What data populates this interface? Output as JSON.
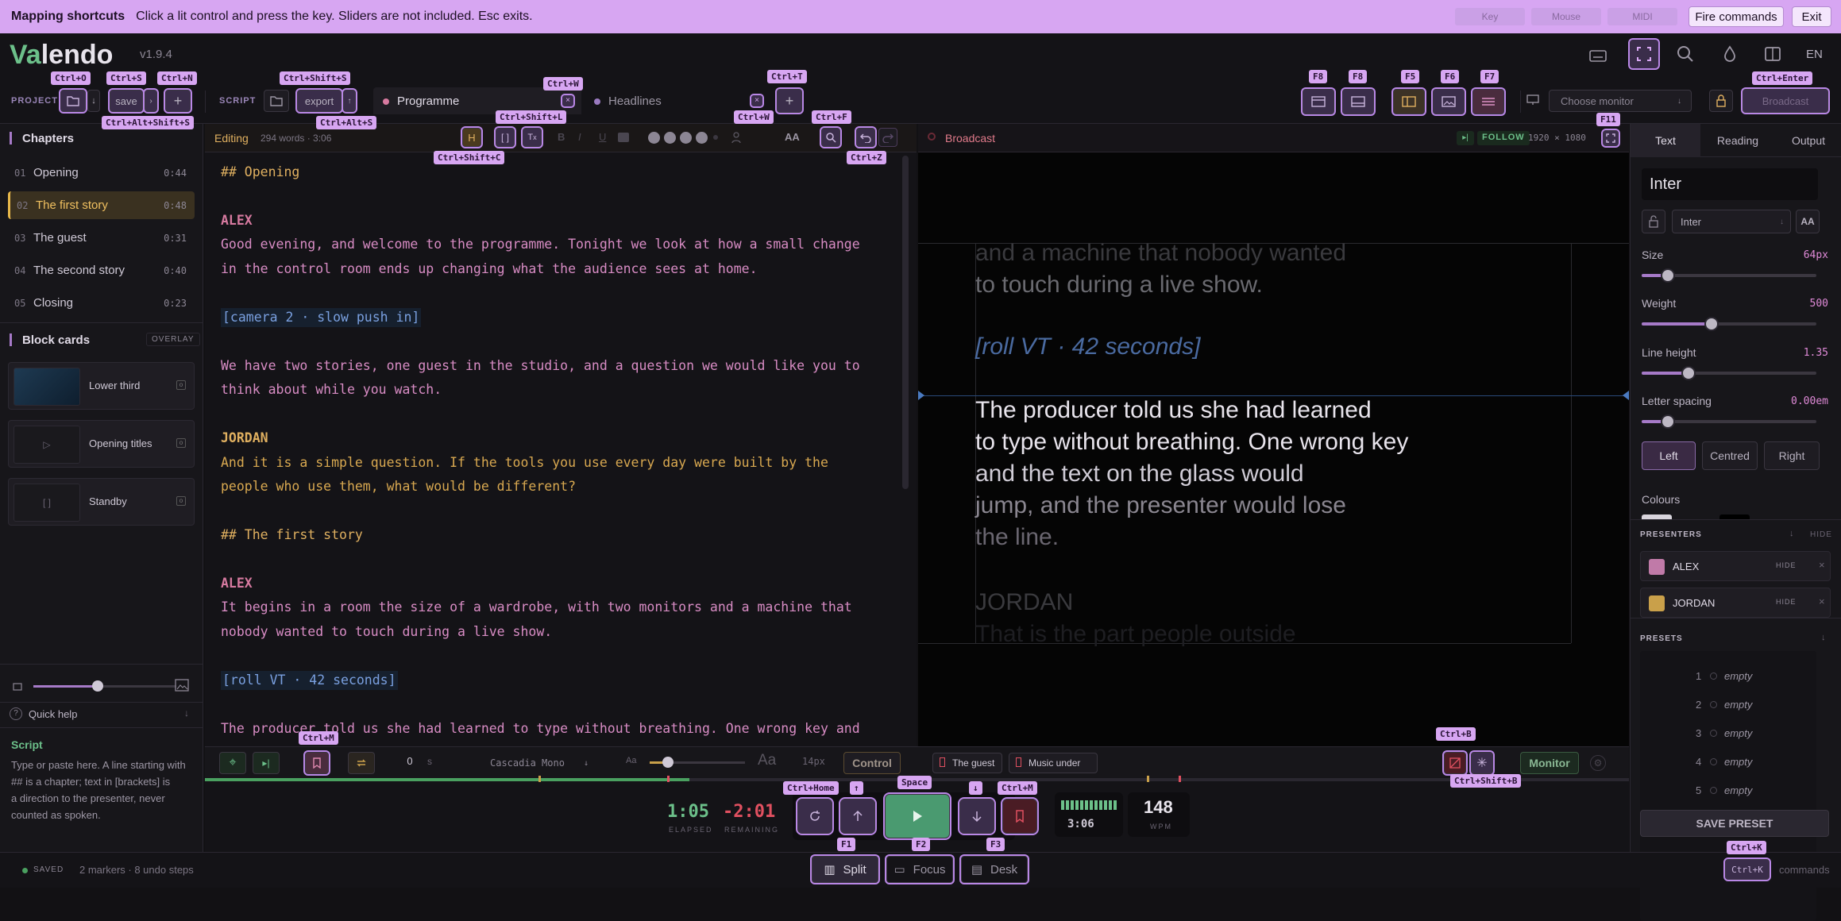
{
  "banner": {
    "title": "Mapping shortcuts",
    "hint": "Click a lit control and press the key. Sliders are not included. Esc exits.",
    "key": "Key",
    "mouse": "Mouse",
    "midi": "MIDI",
    "fire": "Fire commands",
    "exit": "Exit"
  },
  "app": {
    "logo_a": "Va",
    "logo_b": "lendo",
    "version": "v1.9.4",
    "lang": "EN"
  },
  "toolbar": {
    "project_label": "PROJECT",
    "save": "save",
    "script_label": "SCRIPT",
    "export": "export",
    "tab1": "Programme",
    "tab2": "Headlines",
    "monitor_placeholder": "Choose monitor",
    "broadcast": "Broadcast"
  },
  "shortcuts": {
    "open": "Ctrl+O",
    "save": "Ctrl+S",
    "new": "Ctrl+N",
    "save_as": "Ctrl+Alt+Shift+S",
    "export": "Ctrl+Shift+S",
    "export_all": "Ctrl+Alt+S",
    "close_tab": "Ctrl+W",
    "new_tab": "Ctrl+T",
    "close_w": "Ctrl+W",
    "find": "Ctrl+F",
    "undo": "Ctrl+Z",
    "cue": "Ctrl+Shift+C",
    "bracket": "Ctrl+Shift+L",
    "f8a": "F8",
    "f8b": "F8",
    "f5": "F5",
    "f6": "F6",
    "f7": "F7",
    "broadcast": "Ctrl+Enter",
    "fullscreen": "F11",
    "marker": "Ctrl+M",
    "blank": "Ctrl+B",
    "freeze": "Ctrl+Shift+B",
    "home": "Ctrl+Home",
    "up": "↑",
    "space": "Space",
    "down": "↓",
    "mark": "Ctrl+M",
    "f1": "F1",
    "f2": "F2",
    "f3": "F3",
    "cmd": "Ctrl+K"
  },
  "sidebar": {
    "chapters_title": "Chapters",
    "chapters": [
      {
        "n": "01",
        "t": "Opening",
        "d": "0:44"
      },
      {
        "n": "02",
        "t": "The first story",
        "d": "0:48"
      },
      {
        "n": "03",
        "t": "The guest",
        "d": "0:31"
      },
      {
        "n": "04",
        "t": "The second story",
        "d": "0:40"
      },
      {
        "n": "05",
        "t": "Closing",
        "d": "0:23"
      }
    ],
    "cards_title": "Block cards",
    "overlay": "OVERLAY",
    "cards": [
      {
        "name": "Lower third",
        "thumb": ""
      },
      {
        "name": "Opening titles",
        "thumb": "▷"
      },
      {
        "name": "Standby",
        "thumb": "[ ]"
      }
    ],
    "quick_help": "Quick help",
    "help_title": "Script",
    "help_text1": "Type or paste here. A line starting with",
    "help_text2": "## is a chapter; text in [brackets] is",
    "help_text3": "a direction to the presenter, never",
    "help_text4": "counted as spoken."
  },
  "editor": {
    "mode": "Editing",
    "meta": "294 words · 3:06",
    "aa": "AA",
    "lines": [
      "## Opening",
      "ALEX",
      "Good evening, and welcome to the programme. Tonight we look at how a small change",
      "in the control room ends up changing what the audience sees at home.",
      "[camera 2 · slow push in]",
      "We have two stories, one guest in the studio, and a question we would like you to",
      "think about while you watch.",
      "JORDAN",
      "And it is a simple question. If the tools you use every day were built by the",
      "people who use them, what would be different?",
      "## The first story",
      "ALEX",
      "It begins in a room the size of a wardrobe, with two monitors and a machine that",
      "nobody wanted to touch during a live show.",
      "[roll VT · 42 seconds]",
      "The producer told us she had learned to type without breathing. One wrong key and"
    ]
  },
  "broadcast": {
    "title": "Broadcast",
    "follow": "FOLLOW",
    "res": "1920 × 1080",
    "lines": [
      "and a machine that nobody wanted",
      "to touch during a live show.",
      "[roll VT · 42 seconds]",
      "The producer told us she had learned",
      "to type without breathing. One wrong key",
      "and the text on the glass would",
      "jump, and the presenter would lose",
      "the line.",
      "JORDAN",
      "That is the part people outside"
    ]
  },
  "rpanel": {
    "tabs": [
      "Text",
      "Reading",
      "Output"
    ],
    "font_name": "Inter",
    "font_sel": "Inter",
    "aa": "AA",
    "size_label": "Size",
    "size_val": "64px",
    "size_pct": 0.15,
    "weight_label": "Weight",
    "weight_val": "500",
    "weight_pct": 0.4,
    "lh_label": "Line height",
    "lh_val": "1.35",
    "lh_pct": 0.27,
    "ls_label": "Letter spacing",
    "ls_val": "0.00em",
    "ls_pct": 0.15,
    "align": [
      "Left",
      "Centred",
      "Right"
    ],
    "colours": "Colours",
    "presenters_title": "PRESENTERS",
    "hide": "HIDE",
    "presenters": [
      {
        "name": "ALEX",
        "color": "#c07aa8"
      },
      {
        "name": "JORDAN",
        "color": "#c9a04a"
      }
    ],
    "presets_title": "PRESETS",
    "presets": [
      "1",
      "2",
      "3",
      "4",
      "5"
    ],
    "empty": "empty",
    "save_preset": "SAVE PRESET",
    "commands": "commands"
  },
  "ctrl": {
    "speed": "0",
    "unit": "s",
    "font": "Cascadia Mono",
    "aa_small": "Aa",
    "aa_big": "Aa",
    "size": "14px",
    "control": "Control",
    "marker1": "The guest",
    "marker2": "Music under",
    "monitor": "Monitor"
  },
  "transport": {
    "elapsed": "1:05",
    "elapsed_lbl": "ELAPSED",
    "remaining": "-2:01",
    "remaining_lbl": "REMAINING",
    "time": "3:06",
    "wpm": "148",
    "wpm_lbl": "WPM",
    "progress": 0.34
  },
  "footer": {
    "saved": "SAVED",
    "status": "2 markers · 8 undo steps",
    "split": "Split",
    "focus": "Focus",
    "desk": "Desk"
  }
}
